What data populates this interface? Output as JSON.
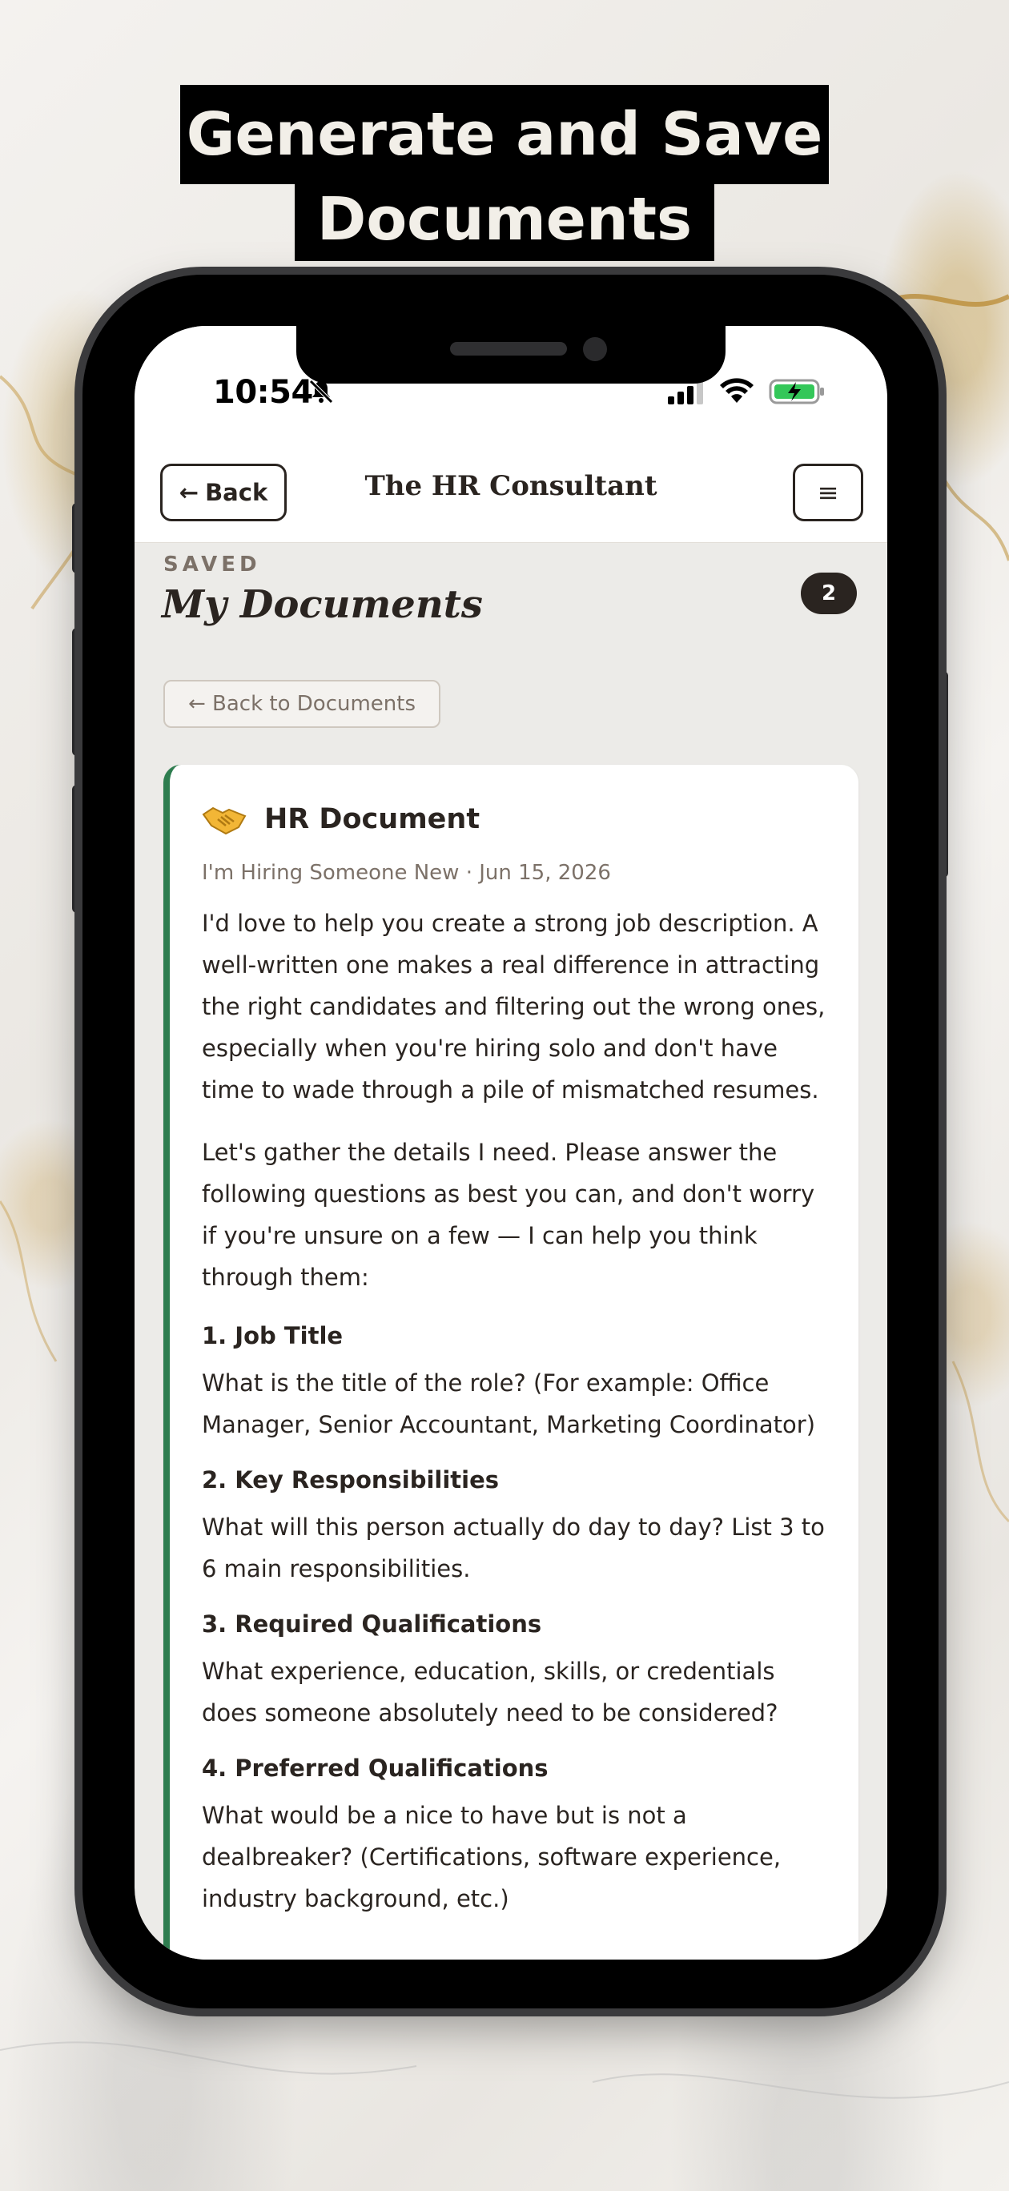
{
  "headline": {
    "line1": "Generate and Save",
    "line2": "Documents"
  },
  "status_bar": {
    "time": "10:54",
    "icons": [
      "bell-mute-icon",
      "cellular-signal-icon",
      "wifi-icon",
      "battery-charging-icon"
    ],
    "battery_color": "#34c759"
  },
  "header": {
    "back_label": "Back",
    "app_title": "The HR Consultant",
    "menu_icon": "≡"
  },
  "page": {
    "section_label": "SAVED",
    "title": "My Documents",
    "count": "2",
    "back_to_documents": "Back to Documents"
  },
  "document": {
    "icon": "handshake-icon",
    "title": "HR Document",
    "meta": "I'm Hiring Someone New · Jun 15, 2026",
    "accent_color": "#2e7d4f",
    "paragraphs": [
      "I'd love to help you create a strong job description. A well-written one makes a real difference in attracting the right candidates and filtering out the wrong ones, especially when you're hiring solo and don't have time to wade through a pile of mismatched resumes.",
      "Let's gather the details I need. Please answer the following questions as best you can, and don't worry if you're unsure on a few — I can help you think through them:"
    ],
    "questions": [
      {
        "heading": "1. Job Title",
        "text": "What is the title of the role? (For example: Office Manager, Senior Accountant, Marketing Coordinator)"
      },
      {
        "heading": "2. Key Responsibilities",
        "text": "What will this person actually do day to day? List 3 to 6 main responsibilities."
      },
      {
        "heading": "3. Required Qualifications",
        "text": "What experience, education, skills, or credentials does someone absolutely need to be considered?"
      },
      {
        "heading": "4. Preferred Qualifications",
        "text": "What would be a nice to have but is not a dealbreaker? (Certifications, software experience, industry background, etc.)"
      }
    ]
  }
}
